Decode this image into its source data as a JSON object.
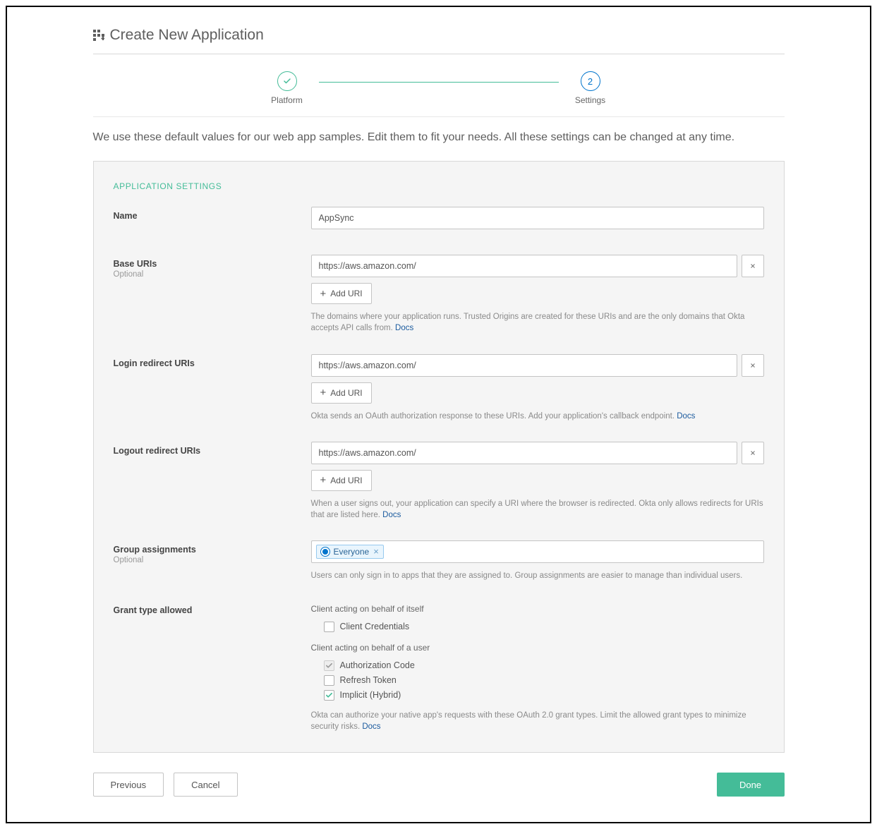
{
  "header": {
    "title": "Create New Application"
  },
  "stepper": {
    "steps": [
      {
        "label": "Platform",
        "done": true
      },
      {
        "label": "Settings",
        "num": "2"
      }
    ]
  },
  "intro": "We use these default values for our web app samples. Edit them to fit your needs. All these settings can be changed at any time.",
  "section_title": "APPLICATION SETTINGS",
  "fields": {
    "name": {
      "label": "Name",
      "value": "AppSync"
    },
    "base_uris": {
      "label": "Base URIs",
      "sub": "Optional",
      "value": "https://aws.amazon.com/",
      "add_label": "Add URI",
      "helper": "The domains where your application runs. Trusted Origins are created for these URIs and are the only domains that Okta accepts API calls from.",
      "docs": "Docs"
    },
    "login_uris": {
      "label": "Login redirect URIs",
      "value": "https://aws.amazon.com/",
      "add_label": "Add URI",
      "helper": "Okta sends an OAuth authorization response to these URIs. Add your application's callback endpoint.",
      "docs": "Docs"
    },
    "logout_uris": {
      "label": "Logout redirect URIs",
      "value": "https://aws.amazon.com/",
      "add_label": "Add URI",
      "helper": "When a user signs out, your application can specify a URI where the browser is redirected. Okta only allows redirects for URIs that are listed here.",
      "docs": "Docs"
    },
    "group_assign": {
      "label": "Group assignments",
      "sub": "Optional",
      "tag": "Everyone",
      "helper": "Users can only sign in to apps that they are assigned to. Group assignments are easier to manage than individual users."
    },
    "grant": {
      "label": "Grant type allowed",
      "self_title": "Client acting on behalf of itself",
      "opt_client_creds": "Client Credentials",
      "user_title": "Client acting on behalf of a user",
      "opt_auth_code": "Authorization Code",
      "opt_refresh": "Refresh Token",
      "opt_implicit": "Implicit (Hybrid)",
      "helper": "Okta can authorize your native app's requests with these OAuth 2.0 grant types. Limit the allowed grant types to minimize security risks.",
      "docs": "Docs"
    }
  },
  "buttons": {
    "previous": "Previous",
    "cancel": "Cancel",
    "done": "Done"
  }
}
